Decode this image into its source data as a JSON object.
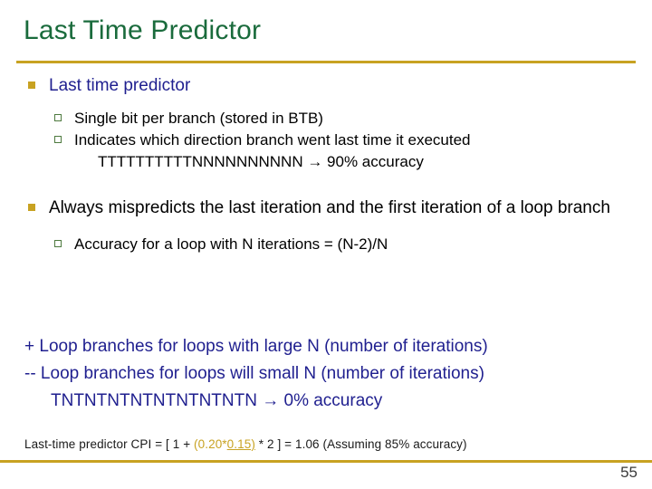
{
  "slide": {
    "title": "Last Time Predictor",
    "page_number": "55",
    "accent_gold": "#c8a222",
    "title_green": "#1a6b3c",
    "body_navy": "#1f1f8f",
    "marker_green": "#4e7a3f"
  },
  "bullets": [
    {
      "level": 1,
      "color": "navy",
      "text": "Last time predictor",
      "children": [
        {
          "text": "Single bit per branch (stored in BTB)"
        },
        {
          "text": "Indicates which direction branch went last time it executed",
          "continuation": "TTTTTTTTTTNNNNNNNNNN → 90% accuracy"
        }
      ]
    },
    {
      "level": 1,
      "color": "black",
      "text": "Always mispredicts the last iteration and the first iteration of a loop branch",
      "children": [
        {
          "text": "Accuracy for a loop with N iterations = (N-2)/N"
        }
      ]
    }
  ],
  "notes": {
    "plus_line": "+ Loop branches for loops with large N (number of iterations)",
    "minus_line": "-- Loop branches for loops will small N (number of iterations)",
    "sequence_line": "TNTNTNTNTNTNTNTNTN →   0% accuracy"
  },
  "footer": {
    "part1": "Last-time predictor CPI = [ 1 + ",
    "highlight_open": "(0.20*",
    "highlight_underlined": "0.15)",
    "part2": " * 2 ]  = 1.06   (Assuming 85% accuracy)"
  }
}
